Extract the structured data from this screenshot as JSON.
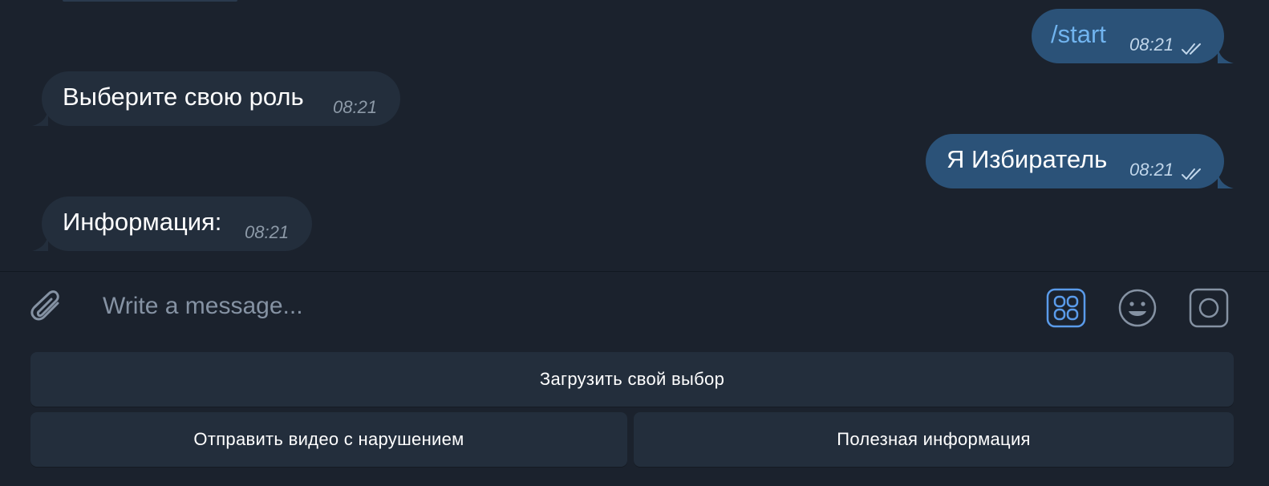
{
  "messages": [
    {
      "direction": "outgoing",
      "text": "/start",
      "time": "08:21",
      "status": "read"
    },
    {
      "direction": "incoming",
      "text": "Выберите свою роль",
      "time": "08:21"
    },
    {
      "direction": "outgoing",
      "text": "Я Избиратель",
      "time": "08:21",
      "status": "read"
    },
    {
      "direction": "incoming",
      "text": "Информация:",
      "time": "08:21"
    }
  ],
  "composer": {
    "placeholder": "Write a message...",
    "attach_icon": "paperclip-icon",
    "commands_icon": "bot-keyboard-icon",
    "emoji_icon": "emoji-icon",
    "camera_icon": "camera-icon"
  },
  "keyboard": {
    "rows": [
      [
        "Загрузить свой выбор"
      ],
      [
        "Отправить видео с нарушением",
        "Полезная информация"
      ]
    ]
  },
  "colors": {
    "background": "#1b222d",
    "incoming_bubble": "#232e3c",
    "outgoing_bubble": "#2b5278",
    "accent": "#5a9bea",
    "command_text": "#71b4ef"
  }
}
